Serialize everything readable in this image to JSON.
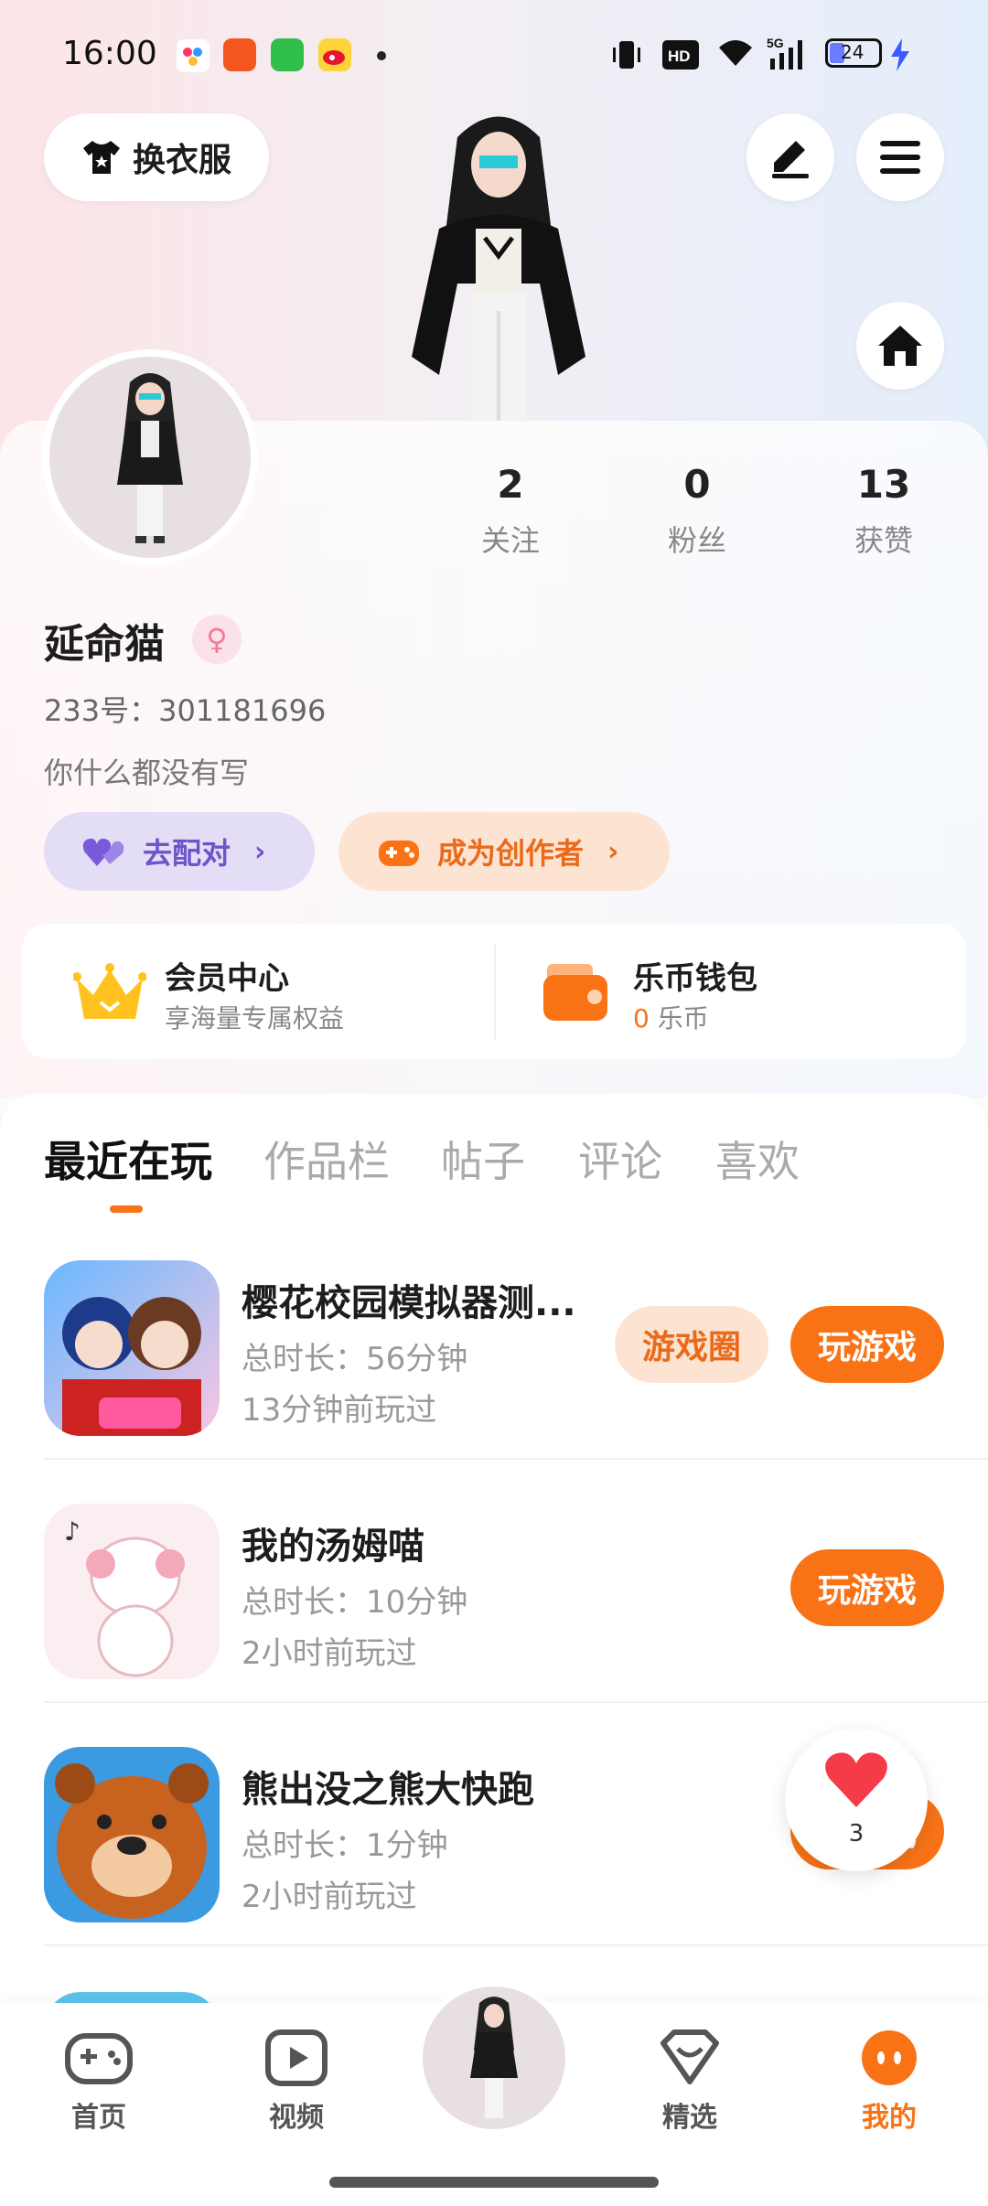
{
  "status_bar": {
    "time": "16:00",
    "battery": "24"
  },
  "header": {
    "outfit_button": "换衣服"
  },
  "profile": {
    "stats": [
      {
        "value": "2",
        "label": "关注"
      },
      {
        "value": "0",
        "label": "粉丝"
      },
      {
        "value": "13",
        "label": "获赞"
      }
    ],
    "name": "延命猫",
    "uid": "233号：301181696",
    "bio": "你什么都没有写",
    "match_button": "去配对",
    "creator_button": "成为创作者"
  },
  "vip_cards": {
    "member_title": "会员中心",
    "member_sub": "享海量专属权益",
    "wallet_title": "乐币钱包",
    "wallet_amount": "0",
    "wallet_unit": "乐币"
  },
  "tabs": [
    "最近在玩",
    "作品栏",
    "帖子",
    "评论",
    "喜欢"
  ],
  "games": [
    {
      "title": "樱花校园模拟器测...",
      "duration": "总时长：56分钟",
      "last_played": "13分钟前玩过",
      "circle": "游戏圈",
      "play": "玩游戏"
    },
    {
      "title": "我的汤姆喵",
      "duration": "总时长：10分钟",
      "last_played": "2小时前玩过",
      "play": "玩游戏"
    },
    {
      "title": "熊出没之熊大快跑",
      "duration": "总时长：1分钟",
      "last_played": "2小时前玩过",
      "play": "玩游戏"
    }
  ],
  "floating_like": {
    "count": "3"
  },
  "nav": [
    {
      "label": "首页"
    },
    {
      "label": "视频"
    },
    {
      "label": "精选"
    },
    {
      "label": "我的"
    }
  ],
  "colors": {
    "accent": "#f97316",
    "accent_light": "#fde3d2",
    "match_purple": "#7a5ad8"
  }
}
